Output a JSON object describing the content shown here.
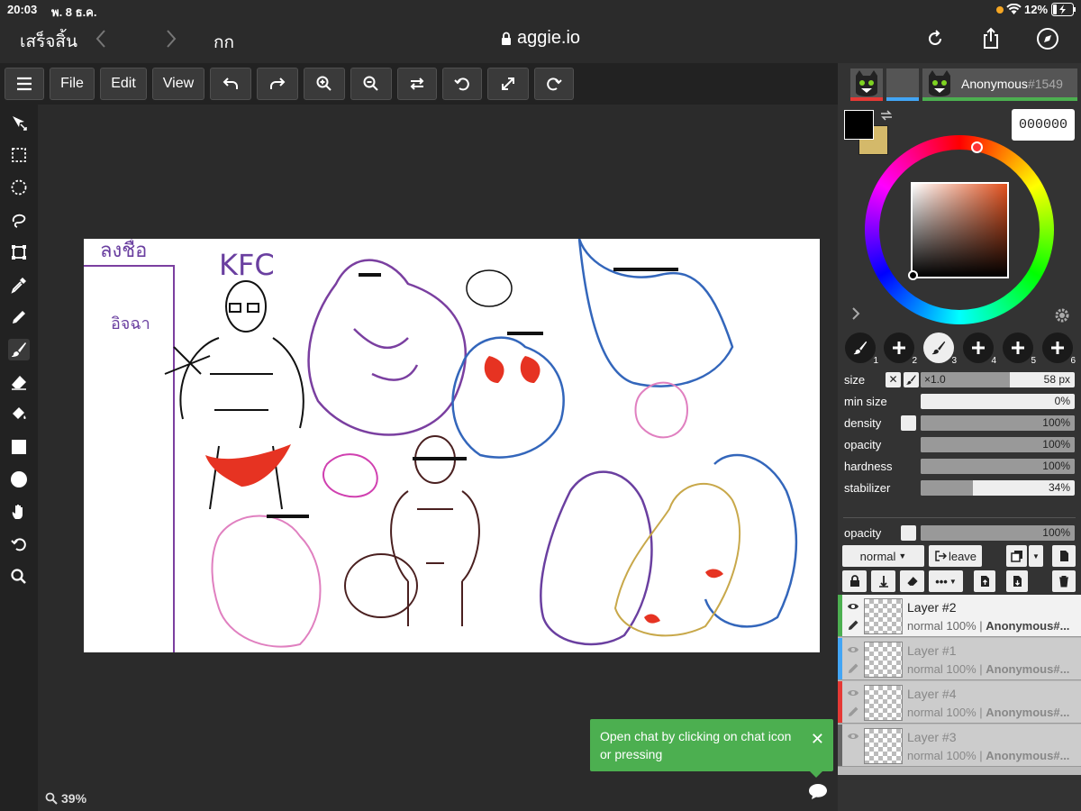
{
  "status": {
    "time": "20:03",
    "date": "พ. 8 ธ.ค.",
    "battery": "12%"
  },
  "safari": {
    "done_label": "เสร็จสิ้น",
    "text_size": "กก",
    "url": "aggie.io"
  },
  "menu": {
    "file": "File",
    "edit": "Edit",
    "view": "View"
  },
  "user": {
    "name": "Anonymous",
    "tag": "#1549"
  },
  "color": {
    "hex": "000000",
    "primary": "#000000",
    "secondary": "#d4b96a"
  },
  "brushes": [
    {
      "num": "1",
      "type": "brush"
    },
    {
      "num": "2",
      "type": "add"
    },
    {
      "num": "3",
      "type": "brush-active"
    },
    {
      "num": "4",
      "type": "add"
    },
    {
      "num": "5",
      "type": "add"
    },
    {
      "num": "6",
      "type": "add"
    }
  ],
  "brush_settings": {
    "size_label": "size",
    "size_mult": "×1.0",
    "size_value": "58 px",
    "size_level": 0.58,
    "min_size_label": "min size",
    "min_size_value": "0%",
    "min_size_level": 0,
    "density_label": "density",
    "density_value": "100%",
    "density_level": 1,
    "opacity_label": "opacity",
    "opacity_value": "100%",
    "opacity_level": 1,
    "hardness_label": "hardness",
    "hardness_value": "100%",
    "hardness_level": 1,
    "stabilizer_label": "stabilizer",
    "stabilizer_value": "34%",
    "stabilizer_level": 0.34
  },
  "layer_settings": {
    "opacity_label": "opacity",
    "opacity_value": "100%",
    "opacity_level": 1,
    "blend_mode": "normal",
    "leave_label": "leave"
  },
  "layers": [
    {
      "name": "Layer #2",
      "mode": "normal",
      "opacity": "100%",
      "owner": "Anonymous#...",
      "color": "#4caf50",
      "active": true
    },
    {
      "name": "Layer #1",
      "mode": "normal",
      "opacity": "100%",
      "owner": "Anonymous#...",
      "color": "#42a5f5",
      "active": false
    },
    {
      "name": "Layer #4",
      "mode": "normal",
      "opacity": "100%",
      "owner": "Anonymous#...",
      "color": "#e53935",
      "active": false
    },
    {
      "name": "Layer #3",
      "mode": "normal",
      "opacity": "100%",
      "owner": "Anonymous#...",
      "color": "#666666",
      "active": false
    }
  ],
  "canvas_text": {
    "kfc": "KFC",
    "top_left": "ลงชื่อ",
    "thai_note": "อิจฉา"
  },
  "chat_toast": {
    "text": "Open chat by clicking on chat icon or pressing"
  },
  "zoom": "39%"
}
